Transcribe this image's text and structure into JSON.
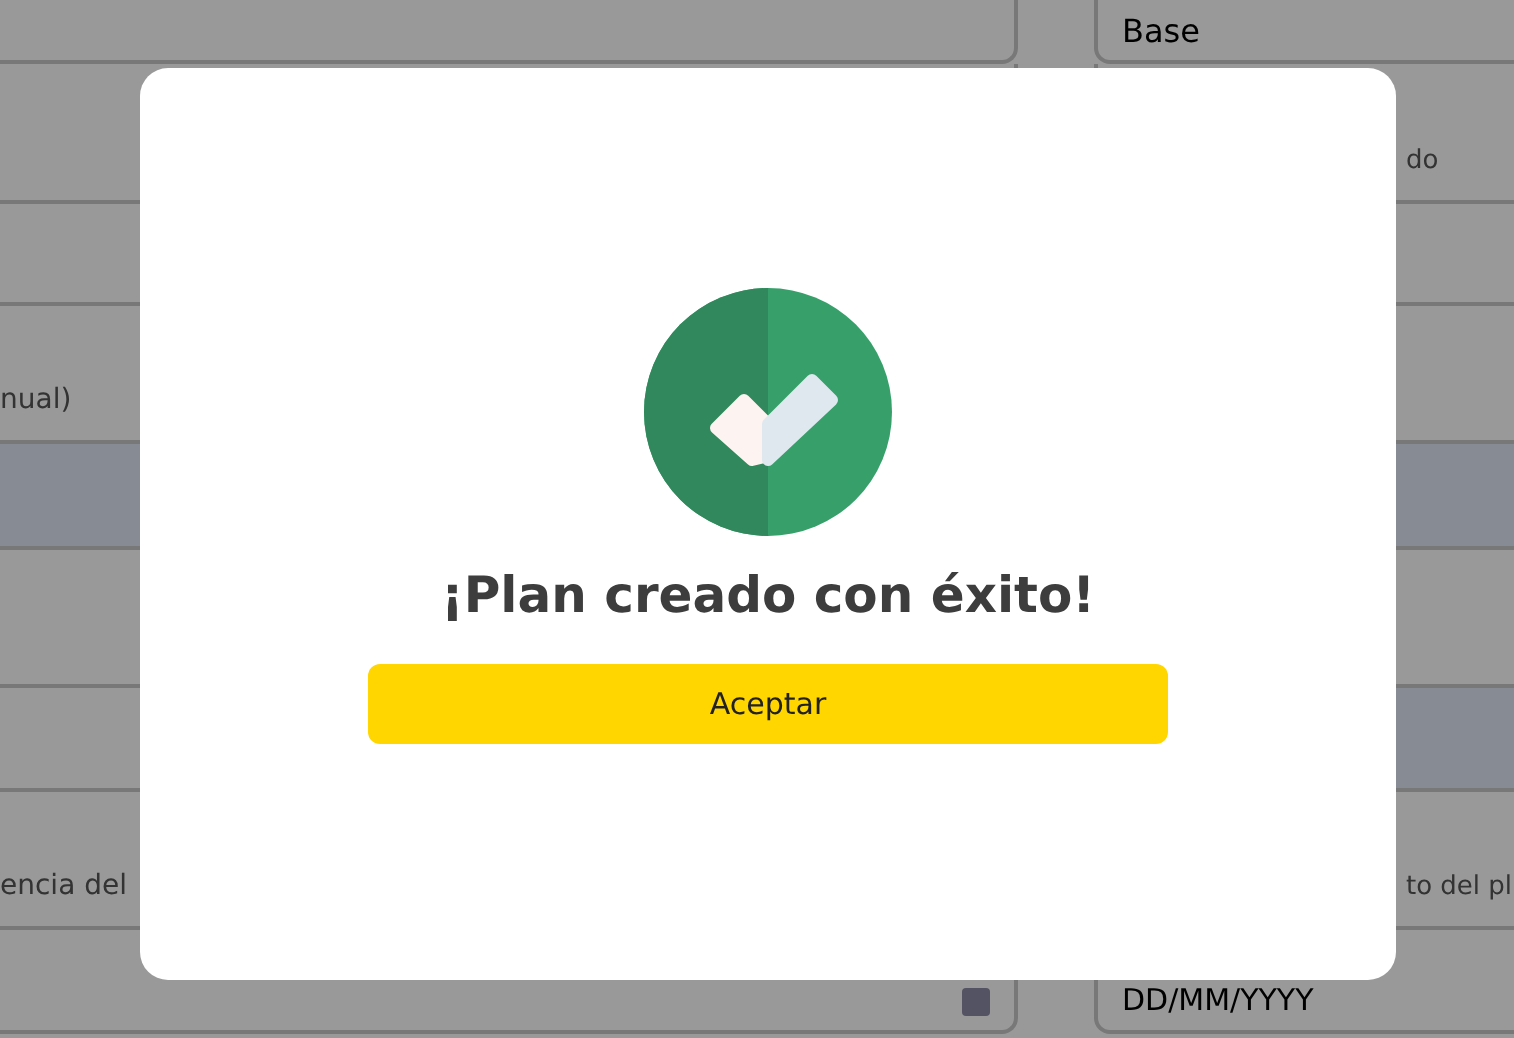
{
  "background_form": {
    "left": [
      {
        "kind": "plain"
      },
      {
        "kind": "plain"
      },
      {
        "kind": "plain"
      },
      {
        "kind": "label",
        "text": "nual)"
      },
      {
        "kind": "shaded"
      },
      {
        "kind": "plain"
      },
      {
        "kind": "plain"
      },
      {
        "kind": "label",
        "text": "encia del"
      },
      {
        "kind": "date"
      }
    ],
    "right": [
      {
        "kind": "field",
        "text": "Base"
      },
      {
        "kind": "label",
        "text": "do"
      },
      {
        "kind": "plain"
      },
      {
        "kind": "plain"
      },
      {
        "kind": "shaded"
      },
      {
        "kind": "plain"
      },
      {
        "kind": "shaded"
      },
      {
        "kind": "label",
        "text": "to del pl"
      },
      {
        "kind": "field",
        "text": "DD/MM/YYYY"
      }
    ]
  },
  "dialog": {
    "title": "¡Plan creado con éxito!",
    "button": "Aceptar"
  }
}
